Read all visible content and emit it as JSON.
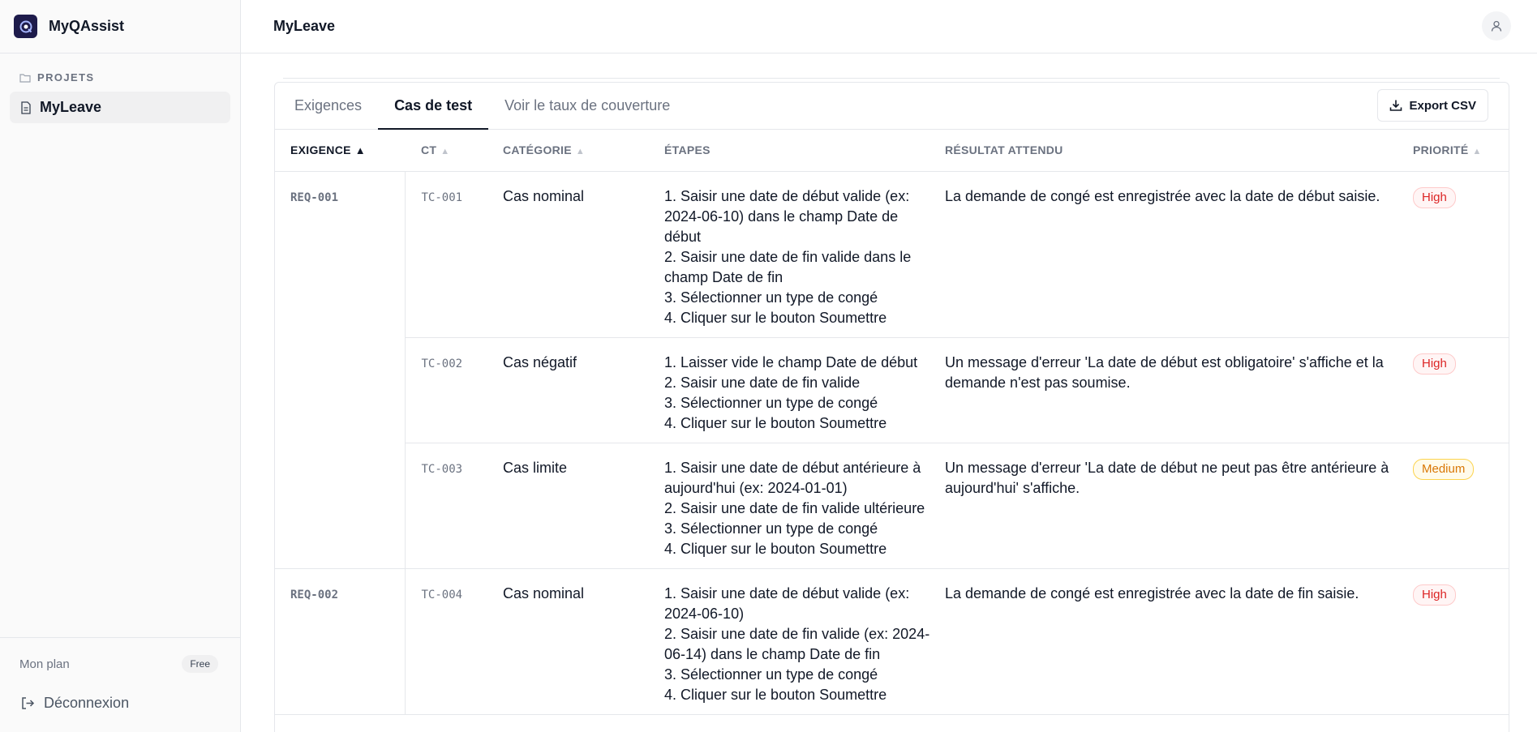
{
  "app": {
    "name": "MyQAssist"
  },
  "sidebar": {
    "section_label": "PROJETS",
    "items": [
      {
        "label": "MyLeave"
      }
    ],
    "plan_label": "Mon plan",
    "plan_badge": "Free",
    "logout_label": "Déconnexion"
  },
  "header": {
    "title": "MyLeave"
  },
  "tabs": [
    {
      "label": "Exigences",
      "active": false
    },
    {
      "label": "Cas de test",
      "active": true
    },
    {
      "label": "Voir le taux de couverture",
      "active": false
    }
  ],
  "export_label": "Export CSV",
  "table": {
    "columns": [
      {
        "label": "EXIGENCE",
        "sort": "▲",
        "sorted": true
      },
      {
        "label": "CT",
        "sort": "▲",
        "sorted": false
      },
      {
        "label": "CATÉGORIE",
        "sort": "▲",
        "sorted": false
      },
      {
        "label": "ÉTAPES",
        "sort": "",
        "sorted": false
      },
      {
        "label": "RÉSULTAT ATTENDU",
        "sort": "",
        "sorted": false
      },
      {
        "label": "PRIORITÉ",
        "sort": "▲",
        "sorted": false
      }
    ],
    "groups": [
      {
        "req": "REQ-001",
        "rows": [
          {
            "ct": "TC-001",
            "category": "Cas nominal",
            "steps": [
              "1. Saisir une date de début valide (ex: 2024-06-10) dans le champ Date de début",
              "2. Saisir une date de fin valide dans le champ Date de fin",
              "3. Sélectionner un type de congé",
              "4. Cliquer sur le bouton Soumettre"
            ],
            "result": "La demande de congé est enregistrée avec la date de début saisie.",
            "priority": "High"
          },
          {
            "ct": "TC-002",
            "category": "Cas négatif",
            "steps": [
              "1. Laisser vide le champ Date de début",
              "2. Saisir une date de fin valide",
              "3. Sélectionner un type de congé",
              "4. Cliquer sur le bouton Soumettre"
            ],
            "result": "Un message d'erreur 'La date de début est obligatoire' s'affiche et la demande n'est pas soumise.",
            "priority": "High"
          },
          {
            "ct": "TC-003",
            "category": "Cas limite",
            "steps": [
              "1. Saisir une date de début antérieure à aujourd'hui (ex: 2024-01-01)",
              "2. Saisir une date de fin valide ultérieure",
              "3. Sélectionner un type de congé",
              "4. Cliquer sur le bouton Soumettre"
            ],
            "result": "Un message d'erreur 'La date de début ne peut pas être antérieure à aujourd'hui' s'affiche.",
            "priority": "Medium"
          }
        ]
      },
      {
        "req": "REQ-002",
        "rows": [
          {
            "ct": "TC-004",
            "category": "Cas nominal",
            "steps": [
              "1. Saisir une date de début valide (ex: 2024-06-10)",
              "2. Saisir une date de fin valide (ex: 2024-06-14) dans le champ Date de fin",
              "3. Sélectionner un type de congé",
              "4. Cliquer sur le bouton Soumettre"
            ],
            "result": "La demande de congé est enregistrée avec la date de fin saisie.",
            "priority": "High"
          }
        ]
      }
    ]
  }
}
